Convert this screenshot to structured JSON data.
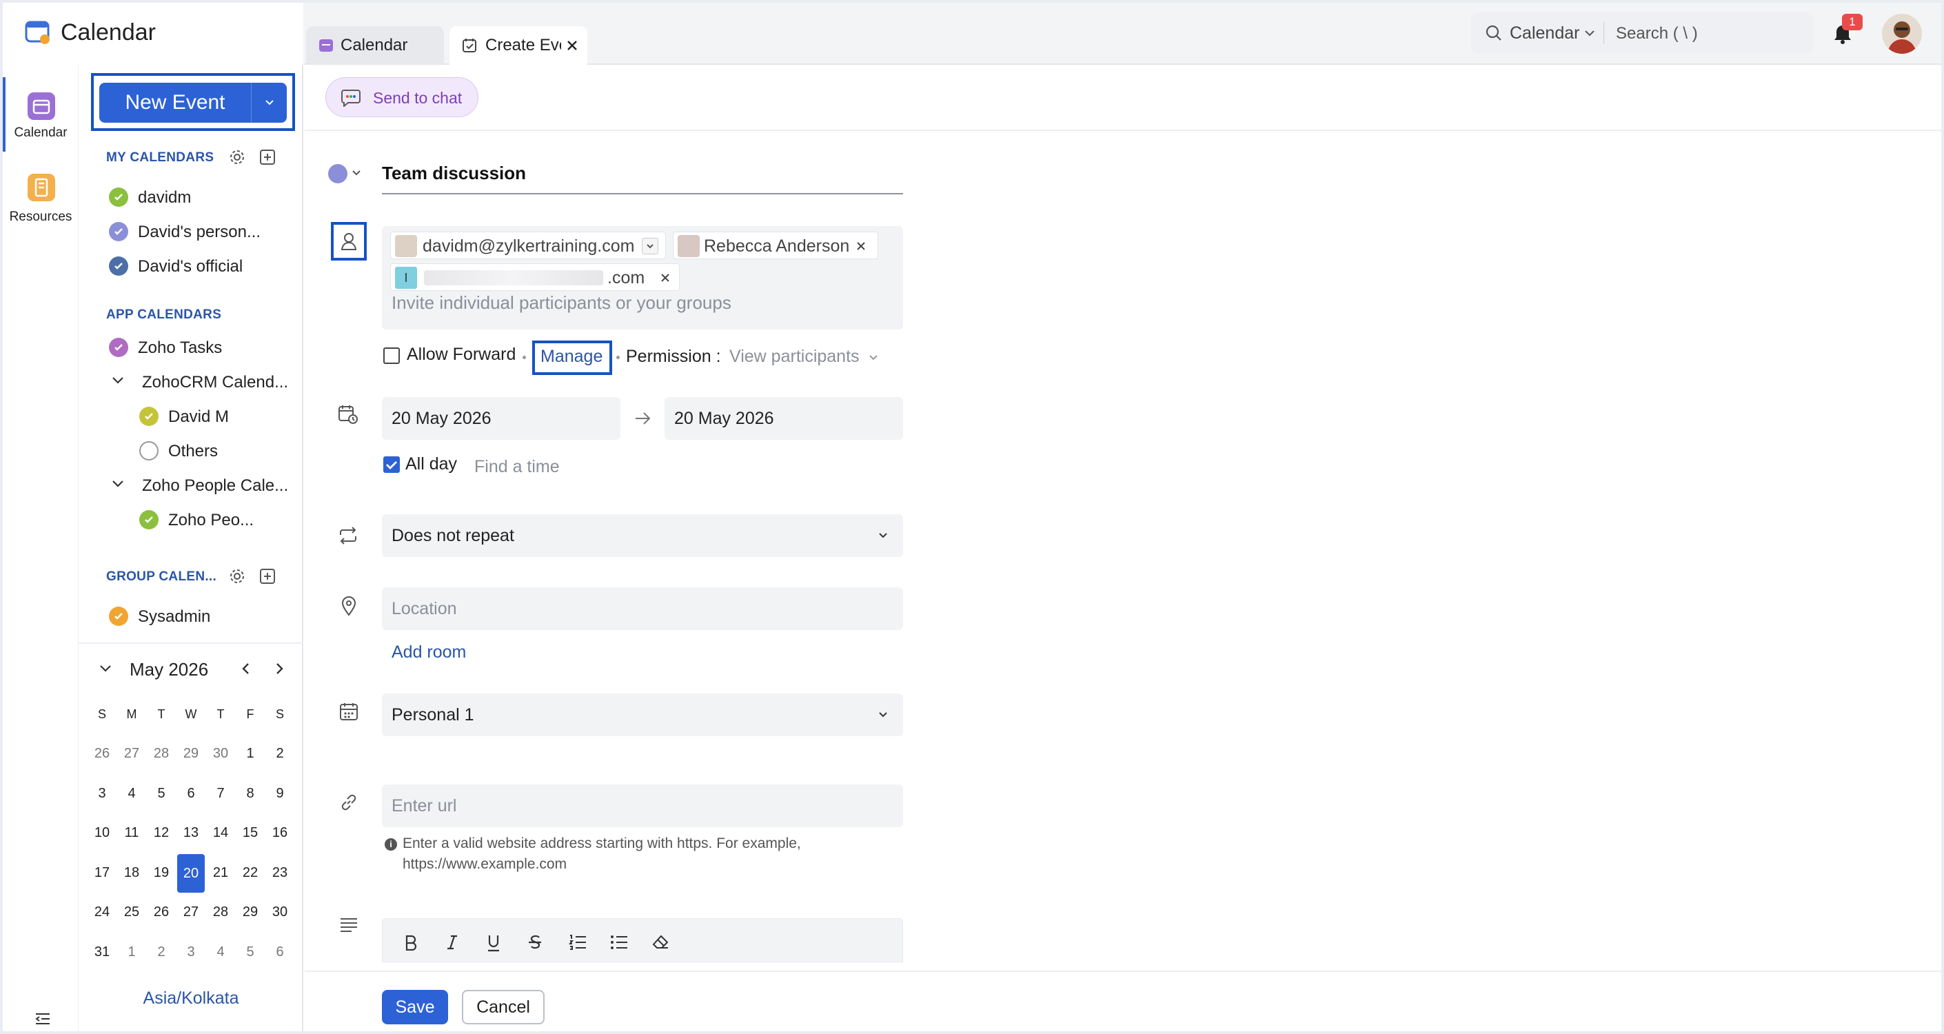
{
  "app": {
    "title": "Calendar"
  },
  "tabs": [
    {
      "label": "Calendar"
    },
    {
      "label": "Create Eve"
    }
  ],
  "topbar": {
    "search_scope": "Calendar",
    "search_placeholder": "Search ( \\ )",
    "notification_count": "1"
  },
  "nav": [
    {
      "label": "Calendar"
    },
    {
      "label": "Resources"
    }
  ],
  "sidebar": {
    "new_event_label": "New Event",
    "my_calendars_title": "MY CALENDARS",
    "my_calendars": [
      {
        "label": "davidm",
        "color": "#8ac03e"
      },
      {
        "label": "David's person...",
        "color": "#8b8fd8"
      },
      {
        "label": "David's official",
        "color": "#4d6fa8"
      }
    ],
    "app_calendars_title": "APP CALENDARS",
    "app_calendars": [
      {
        "label": "Zoho Tasks",
        "color": "#b06bc2"
      },
      {
        "label": "ZohoCRM Calend...",
        "color": ""
      },
      {
        "label": "David M",
        "color": "#c4c43a"
      },
      {
        "label": "Others",
        "color": ""
      },
      {
        "label": "Zoho People Cale...",
        "color": ""
      },
      {
        "label": "Zoho Peo...",
        "color": "#8ac03e"
      }
    ],
    "group_calendars_title": "GROUP CALEN...",
    "group_calendars": [
      {
        "label": "Sysadmin",
        "color": "#f0a531"
      }
    ],
    "mini_calendar": {
      "month_label": "May 2026",
      "weekdays": [
        "S",
        "M",
        "T",
        "W",
        "T",
        "F",
        "S"
      ],
      "weeks": [
        [
          "26",
          "27",
          "28",
          "29",
          "30",
          "1",
          "2"
        ],
        [
          "3",
          "4",
          "5",
          "6",
          "7",
          "8",
          "9"
        ],
        [
          "10",
          "11",
          "12",
          "13",
          "14",
          "15",
          "16"
        ],
        [
          "17",
          "18",
          "19",
          "20",
          "21",
          "22",
          "23"
        ],
        [
          "24",
          "25",
          "26",
          "27",
          "28",
          "29",
          "30"
        ],
        [
          "31",
          "1",
          "2",
          "3",
          "4",
          "5",
          "6"
        ]
      ],
      "selected_day": "20"
    },
    "timezone": "Asia/Kolkata"
  },
  "form": {
    "send_to_chat": "Send to chat",
    "title_value": "Team discussion",
    "participants": [
      {
        "label": "davidm@zylkertraining.com"
      },
      {
        "label": "Rebecca Anderson"
      },
      {
        "label": ".com",
        "initial": "I"
      }
    ],
    "invite_placeholder": "Invite individual participants or your groups",
    "allow_forward": "Allow Forward",
    "manage": "Manage",
    "permission_label": "Permission :",
    "permission_value": "View participants",
    "start_date": "20 May 2026",
    "end_date": "20 May 2026",
    "all_day": "All day",
    "find_time": "Find a time",
    "repeat": "Does not repeat",
    "location_placeholder": "Location",
    "add_room": "Add room",
    "calendar_select": "Personal 1",
    "url_placeholder": "Enter url",
    "url_hint_line1": "Enter a valid website address starting with https. For example,",
    "url_hint_line2": "https://www.example.com",
    "save": "Save",
    "cancel": "Cancel"
  },
  "colors": {
    "accent": "#2d62d6",
    "highlight": "#1553c3",
    "link": "#2a55a8"
  }
}
